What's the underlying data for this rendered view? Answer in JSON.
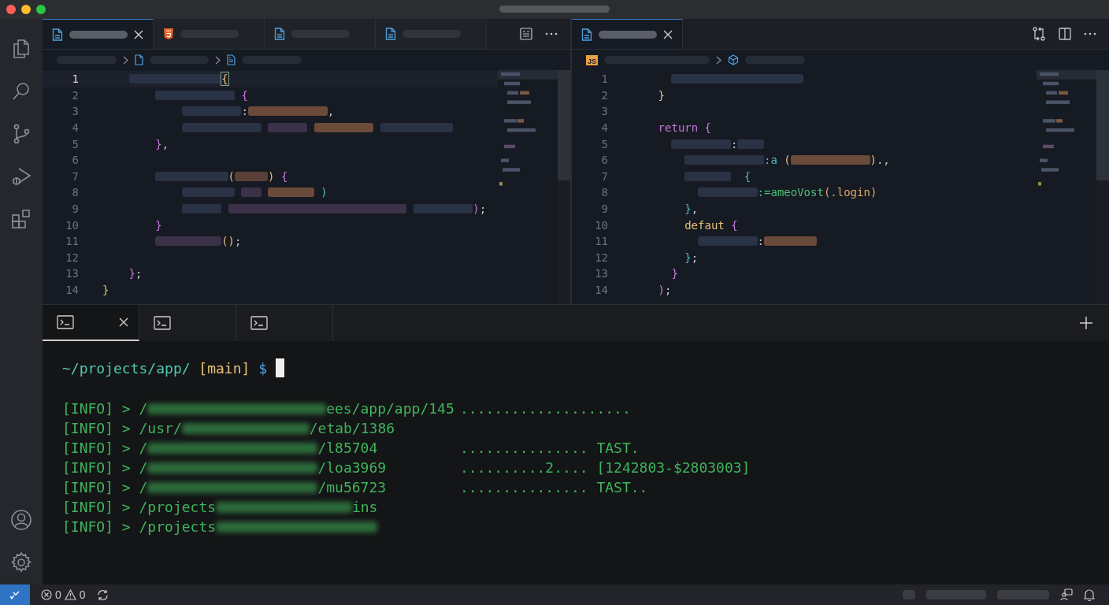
{
  "editors": [
    {
      "tabs": [
        {
          "kind": "file",
          "selected": true
        },
        {
          "kind": "html",
          "selected": false
        },
        {
          "kind": "file",
          "selected": false
        },
        {
          "kind": "file",
          "selected": false
        }
      ],
      "breadcrumbs": [
        {
          "kind": "bar"
        },
        {
          "kind": "chevron"
        },
        {
          "kind": "file"
        },
        {
          "kind": "bar"
        },
        {
          "kind": "chevron"
        },
        {
          "kind": "outline"
        },
        {
          "kind": "bar"
        }
      ],
      "lines": [
        {
          "number": "1",
          "current": true,
          "tokens": [
            {
              "kind": "bar",
              "color": "#2a3245"
            },
            {
              "kind": "match",
              "text": "{",
              "color": "#e5c07b"
            }
          ]
        },
        {
          "number": "2",
          "current": false,
          "tokens": [
            {
              "kind": "bar",
              "color": "#2a3245"
            },
            {
              "kind": "text",
              "text": " {",
              "color": "#c678dd"
            }
          ]
        },
        {
          "number": "3",
          "current": false,
          "tokens": [
            {
              "kind": "bar",
              "color": "#2a3245"
            },
            {
              "kind": "text",
              "text": ":"
            },
            {
              "kind": "bar",
              "color": "#6b4a3a"
            },
            {
              "kind": "text",
              "text": ","
            }
          ]
        },
        {
          "number": "4",
          "current": false,
          "tokens": [
            {
              "kind": "bar",
              "color": "#2a3245"
            },
            {
              "kind": "bar",
              "color": "#3b3148"
            },
            {
              "kind": "bar",
              "color": "#6b4a3a"
            },
            {
              "kind": "bar",
              "color": "#2a3245"
            }
          ]
        },
        {
          "number": "5",
          "current": false,
          "tokens": [
            {
              "kind": "text",
              "text": "}",
              "color": "#c678dd"
            },
            {
              "kind": "text",
              "text": ","
            }
          ]
        },
        {
          "number": "6",
          "current": false
        },
        {
          "number": "7",
          "current": false,
          "tokens": [
            {
              "kind": "bar",
              "color": "#2a3245"
            },
            {
              "kind": "text",
              "text": "(",
              "color": "#e5c07b"
            },
            {
              "kind": "bar",
              "color": "#5a4038"
            },
            {
              "kind": "text",
              "text": ")",
              "color": "#e5c07b"
            },
            {
              "kind": "text",
              "text": " {",
              "color": "#c678dd"
            }
          ]
        },
        {
          "number": "8",
          "current": false,
          "tokens": [
            {
              "kind": "bar",
              "color": "#2a3245"
            },
            {
              "kind": "bar",
              "color": "#3b3148"
            },
            {
              "kind": "bar",
              "color": "#6b4a3a"
            },
            {
              "kind": "text",
              "text": " )",
              "color": "#56b6c2"
            }
          ]
        },
        {
          "number": "9",
          "current": false,
          "tokens": [
            {
              "kind": "bar",
              "color": "#2a3245"
            },
            {
              "kind": "bar",
              "color": "#3b3148"
            },
            {
              "kind": "bar",
              "color": "#2a3245"
            },
            {
              "kind": "text",
              "text": ")",
              "color": "#c678dd"
            },
            {
              "kind": "text",
              "text": ";"
            }
          ]
        },
        {
          "number": "10",
          "current": false,
          "tokens": [
            {
              "kind": "text",
              "text": "}",
              "color": "#c678dd"
            }
          ]
        },
        {
          "number": "11",
          "current": false,
          "tokens": [
            {
              "kind": "bar",
              "color": "#3b3148"
            },
            {
              "kind": "text",
              "text": "()",
              "color": "#e5c07b"
            },
            {
              "kind": "text",
              "text": ";"
            }
          ]
        },
        {
          "number": "12",
          "current": false
        },
        {
          "number": "13",
          "current": false,
          "tokens": [
            {
              "kind": "text",
              "text": "}",
              "color": "#c678dd"
            },
            {
              "kind": "text",
              "text": ";"
            }
          ]
        },
        {
          "number": "14",
          "current": false,
          "tokens": [
            {
              "kind": "text",
              "text": "}",
              "color": "#e5c07b"
            }
          ]
        }
      ]
    },
    {
      "tabs": [
        {
          "kind": "file",
          "selected": true
        }
      ],
      "breadcrumbs": [
        {
          "kind": "js",
          "text": "JS"
        },
        {
          "kind": "bar"
        },
        {
          "kind": "chevron"
        },
        {
          "kind": "cube"
        },
        {
          "kind": "bar"
        }
      ],
      "lines": [
        {
          "number": "1",
          "current": false,
          "tokens": [
            {
              "kind": "bar",
              "color": "#2a3245"
            }
          ]
        },
        {
          "number": "2",
          "current": false,
          "tokens": [
            {
              "kind": "text",
              "text": "}",
              "color": "#e5c07b"
            }
          ]
        },
        {
          "number": "3",
          "current": false
        },
        {
          "number": "4",
          "current": false,
          "tokens": [
            {
              "kind": "text",
              "text": "return {",
              "color": "#c678dd"
            }
          ]
        },
        {
          "number": "5",
          "current": false,
          "tokens": [
            {
              "kind": "bar",
              "color": "#2a3245"
            },
            {
              "kind": "text",
              "text": ":"
            },
            {
              "kind": "bar",
              "color": "#2a3245"
            }
          ]
        },
        {
          "number": "6",
          "current": false,
          "tokens": [
            {
              "kind": "bar",
              "color": "#2a3245"
            },
            {
              "kind": "text",
              "text": ":a",
              "color": "#56b6c2"
            },
            {
              "kind": "text",
              "text": " (",
              "color": "#e5c07b"
            },
            {
              "kind": "bar",
              "color": "#6b4a3a"
            },
            {
              "kind": "text",
              "text": ")",
              "color": "#e5c07b"
            },
            {
              "kind": "text",
              "text": ".,"
            }
          ]
        },
        {
          "number": "7",
          "current": false,
          "tokens": [
            {
              "kind": "bar",
              "color": "#2a3245"
            },
            {
              "kind": "text",
              "text": "  {",
              "color": "#56b6c2"
            }
          ]
        },
        {
          "number": "8",
          "current": false,
          "tokens": [
            {
              "kind": "bar",
              "color": "#2a3245"
            },
            {
              "kind": "text",
              "text": ":=ameoVost",
              "color": "#4ec27a"
            },
            {
              "kind": "text",
              "text": "(.login)",
              "color": "#e0a96d"
            }
          ]
        },
        {
          "number": "9",
          "current": false,
          "tokens": [
            {
              "kind": "text",
              "text": "}",
              "color": "#56b6c2"
            },
            {
              "kind": "text",
              "text": ","
            }
          ]
        },
        {
          "number": "10",
          "current": false,
          "tokens": [
            {
              "kind": "text",
              "text": "defaut",
              "color": "#e5c07b"
            },
            {
              "kind": "text",
              "text": " {",
              "color": "#c678dd"
            }
          ]
        },
        {
          "number": "11",
          "current": false,
          "tokens": [
            {
              "kind": "bar",
              "color": "#2a3245"
            },
            {
              "kind": "text",
              "text": ":"
            },
            {
              "kind": "bar",
              "color": "#6b4a3a"
            }
          ]
        },
        {
          "number": "12",
          "current": false,
          "tokens": [
            {
              "kind": "text",
              "text": "}",
              "color": "#56b6c2"
            },
            {
              "kind": "text",
              "text": ";"
            }
          ]
        },
        {
          "number": "13",
          "current": false,
          "tokens": [
            {
              "kind": "text",
              "text": "}",
              "color": "#c678dd"
            }
          ]
        },
        {
          "number": "14",
          "current": false,
          "tokens": [
            {
              "kind": "text",
              "text": ")",
              "color": "#c678dd"
            },
            {
              "kind": "text",
              "text": ";"
            }
          ]
        }
      ]
    }
  ],
  "terminal": {
    "tabs": [
      {
        "selected": true
      },
      {
        "selected": false
      },
      {
        "selected": false
      }
    ],
    "prompt": {
      "path": "~/projects/app/",
      "branch": "[main]",
      "symbol": "$"
    },
    "lines": [
      {
        "parts": [
          {
            "kind": "text",
            "text": "[INFO] > /"
          },
          {
            "kind": "blur"
          },
          {
            "kind": "text",
            "text": "ees/app/app/145"
          }
        ],
        "result": "...................."
      },
      {
        "parts": [
          {
            "kind": "text",
            "text": "[INFO] > /usr/"
          },
          {
            "kind": "blur"
          },
          {
            "kind": "text",
            "text": "/etab/1386"
          }
        ]
      },
      {
        "parts": [
          {
            "kind": "text",
            "text": "[INFO] > /"
          },
          {
            "kind": "blur"
          },
          {
            "kind": "text",
            "text": "/l85704"
          }
        ],
        "result": "............... TAST."
      },
      {
        "parts": [
          {
            "kind": "text",
            "text": "[INFO] > /"
          },
          {
            "kind": "blur"
          },
          {
            "kind": "text",
            "text": "/loa3969"
          }
        ],
        "result": "..........2.... [1242803-$2803003]"
      },
      {
        "parts": [
          {
            "kind": "text",
            "text": "[INFO] > /"
          },
          {
            "kind": "blur"
          },
          {
            "kind": "text",
            "text": "/mu56723"
          }
        ],
        "result": "............... TAST.."
      },
      {
        "parts": [
          {
            "kind": "text",
            "text": "[INFO] > /projects"
          },
          {
            "kind": "blur"
          },
          {
            "kind": "text",
            "text": "ins"
          }
        ]
      },
      {
        "parts": [
          {
            "kind": "text",
            "text": "[INFO] > /projects"
          },
          {
            "kind": "blur"
          }
        ]
      }
    ]
  },
  "status_bar": {
    "errors": "0",
    "warnings": "0"
  }
}
